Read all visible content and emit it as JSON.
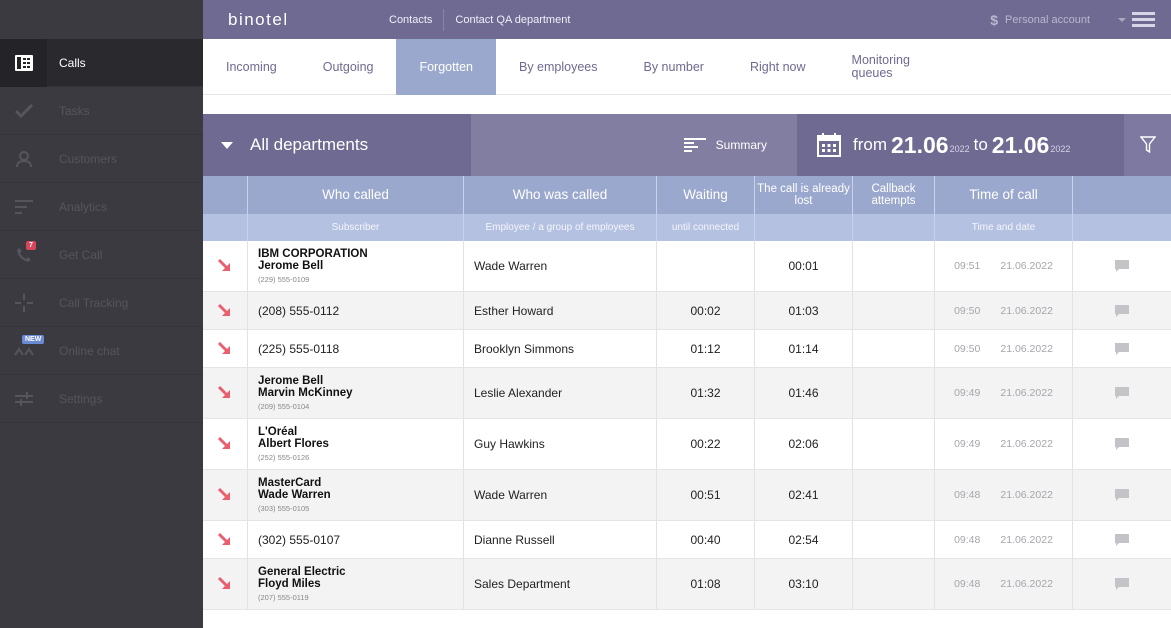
{
  "app": {
    "logo": "binotel"
  },
  "topbar": {
    "links": [
      "Contacts",
      "Contact QA department"
    ],
    "account": "Personal account"
  },
  "sidebar": {
    "items": [
      {
        "label": "Calls",
        "icon": "calls-icon",
        "active": true
      },
      {
        "label": "Tasks",
        "icon": "check-icon"
      },
      {
        "label": "Customers",
        "icon": "user-icon"
      },
      {
        "label": "Analytics",
        "icon": "analytics-icon"
      },
      {
        "label": "Get Call",
        "icon": "getcall-icon",
        "badge": "7"
      },
      {
        "label": "Call Tracking",
        "icon": "tracking-icon"
      },
      {
        "label": "Online chat",
        "icon": "chat-icon",
        "badge": "NEW"
      },
      {
        "label": "Settings",
        "icon": "settings-icon"
      }
    ]
  },
  "tabs": [
    "Incoming",
    "Outgoing",
    "Forgotten",
    "By employees",
    "By number",
    "Right now",
    "Monitoring queues"
  ],
  "active_tab": "Forgotten",
  "filter": {
    "department": "All departments",
    "summary": "Summary",
    "from_label": "from",
    "from_date": "21.06",
    "from_year": "2022",
    "to_label": "to",
    "to_date": "21.06",
    "to_year": "2022"
  },
  "table": {
    "headers": [
      "Who called",
      "Who was called",
      "Waiting",
      "The call is already lost",
      "Callback attempts",
      "Time of call"
    ],
    "subheaders": [
      "Subscriber",
      "Employee / a group of employees",
      "until connected",
      "",
      "",
      "Time and date"
    ],
    "rows": [
      {
        "names": [
          "IBM CORPORATION",
          "Jerome Bell"
        ],
        "phone": "(229) 555-0109",
        "called": "Wade Warren",
        "waiting": "",
        "lost": "00:01",
        "attempts": "",
        "time": "09:51",
        "date": "21.06.2022"
      },
      {
        "names": [],
        "phone": "(208) 555-0112",
        "called": "Esther Howard",
        "waiting": "00:02",
        "lost": "01:03",
        "attempts": "",
        "time": "09:50",
        "date": "21.06.2022"
      },
      {
        "names": [],
        "phone": "(225) 555-0118",
        "called": "Brooklyn Simmons",
        "waiting": "01:12",
        "lost": "01:14",
        "attempts": "",
        "time": "09:50",
        "date": "21.06.2022"
      },
      {
        "names": [
          "Jerome Bell",
          "Marvin McKinney"
        ],
        "phone": "(209) 555-0104",
        "called": "Leslie Alexander",
        "waiting": "01:32",
        "lost": "01:46",
        "attempts": "",
        "time": "09:49",
        "date": "21.06.2022"
      },
      {
        "names": [
          "L'Oréal",
          "Albert Flores"
        ],
        "phone": "(252) 555-0126",
        "called": "Guy Hawkins",
        "waiting": "00:22",
        "lost": "02:06",
        "attempts": "",
        "time": "09:49",
        "date": "21.06.2022"
      },
      {
        "names": [
          "MasterCard",
          "Wade Warren"
        ],
        "phone": "(303) 555-0105",
        "called": "Wade Warren",
        "waiting": "00:51",
        "lost": "02:41",
        "attempts": "",
        "time": "09:48",
        "date": "21.06.2022"
      },
      {
        "names": [],
        "phone": "(302) 555-0107",
        "called": "Dianne Russell",
        "waiting": "00:40",
        "lost": "02:54",
        "attempts": "",
        "time": "09:48",
        "date": "21.06.2022"
      },
      {
        "names": [
          "General Electric",
          "Floyd Miles"
        ],
        "phone": "(207) 555-0119",
        "called": "Sales Department",
        "waiting": "01:08",
        "lost": "03:10",
        "attempts": "",
        "time": "09:48",
        "date": "21.06.2022"
      }
    ]
  },
  "colors": {
    "header": "#6f6a91",
    "accent": "#9aa8cd",
    "missed_arrow": "#e85f6f"
  }
}
